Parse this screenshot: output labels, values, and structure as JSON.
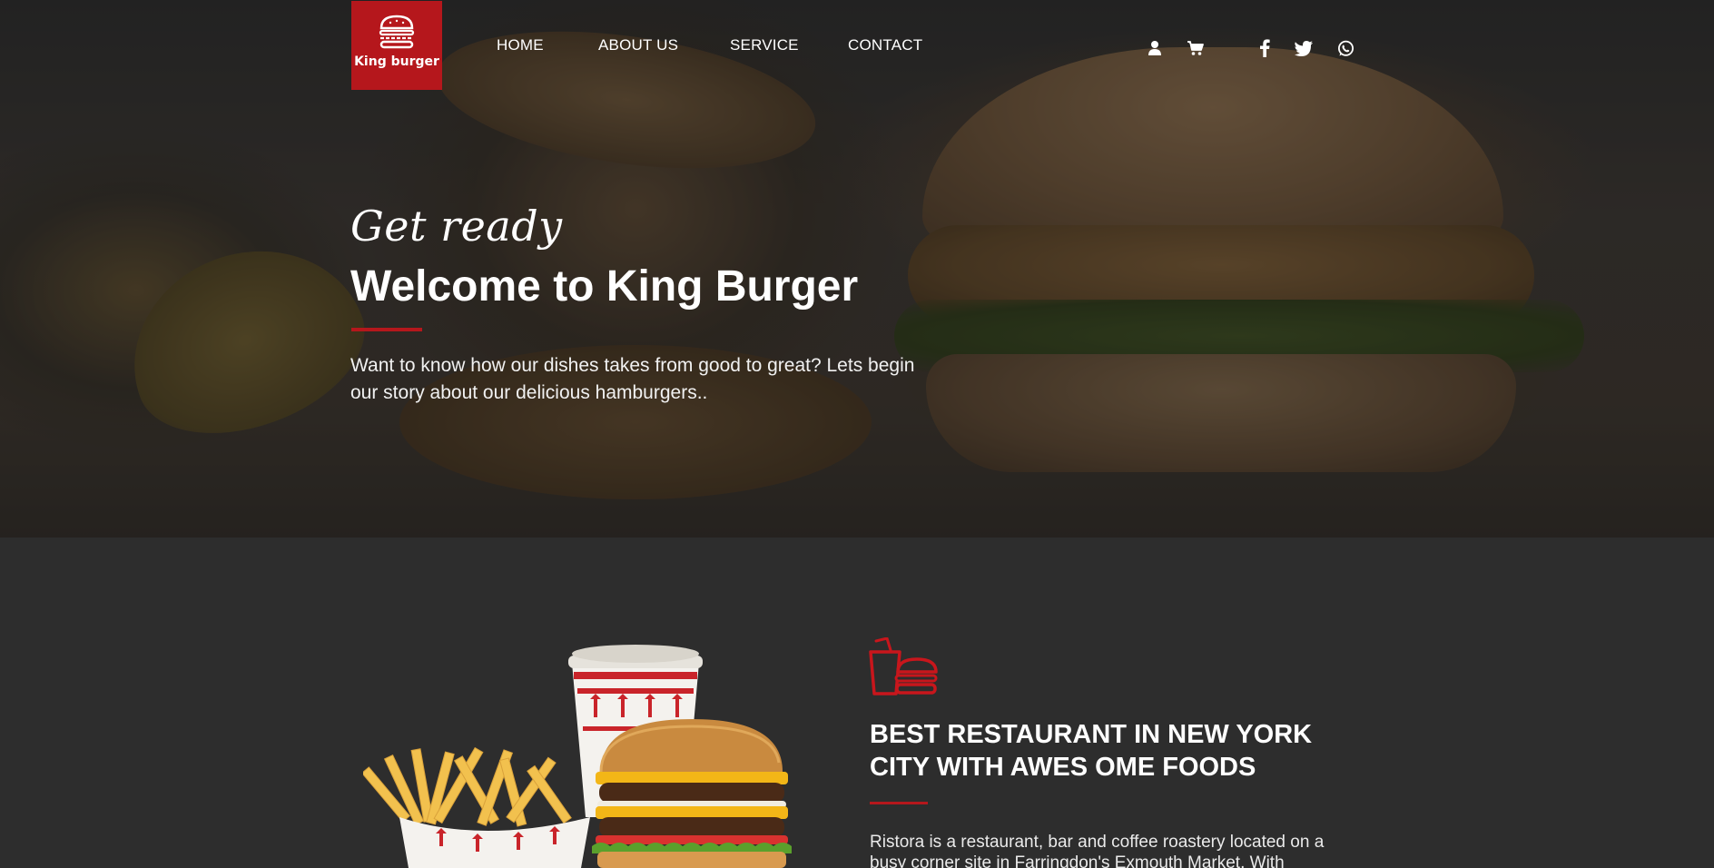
{
  "brand": {
    "name": "King burger",
    "accent": "#b5171c"
  },
  "nav": {
    "items": [
      {
        "label": "HOME"
      },
      {
        "label": "ABOUT US"
      },
      {
        "label": "SERVICE"
      },
      {
        "label": "CONTACT"
      }
    ]
  },
  "header_icons": {
    "account": "user-icon",
    "cart": "cart-icon",
    "social": [
      "facebook-icon",
      "twitter-icon",
      "whatsapp-icon"
    ]
  },
  "hero": {
    "kicker": "Get ready",
    "title": "Welcome to King Burger",
    "description": "Want to know how our dishes takes from good to great? Lets begin our story about our delicious hamburgers.."
  },
  "about": {
    "icon": "burger-drink-icon",
    "title": "BEST RESTAURANT IN NEW YORK CITY WITH AWES OME FOODS",
    "text": "Ristora is a restaurant, bar and coffee roastery located on a busy corner site in Farringdon's Exmouth Market. With"
  }
}
